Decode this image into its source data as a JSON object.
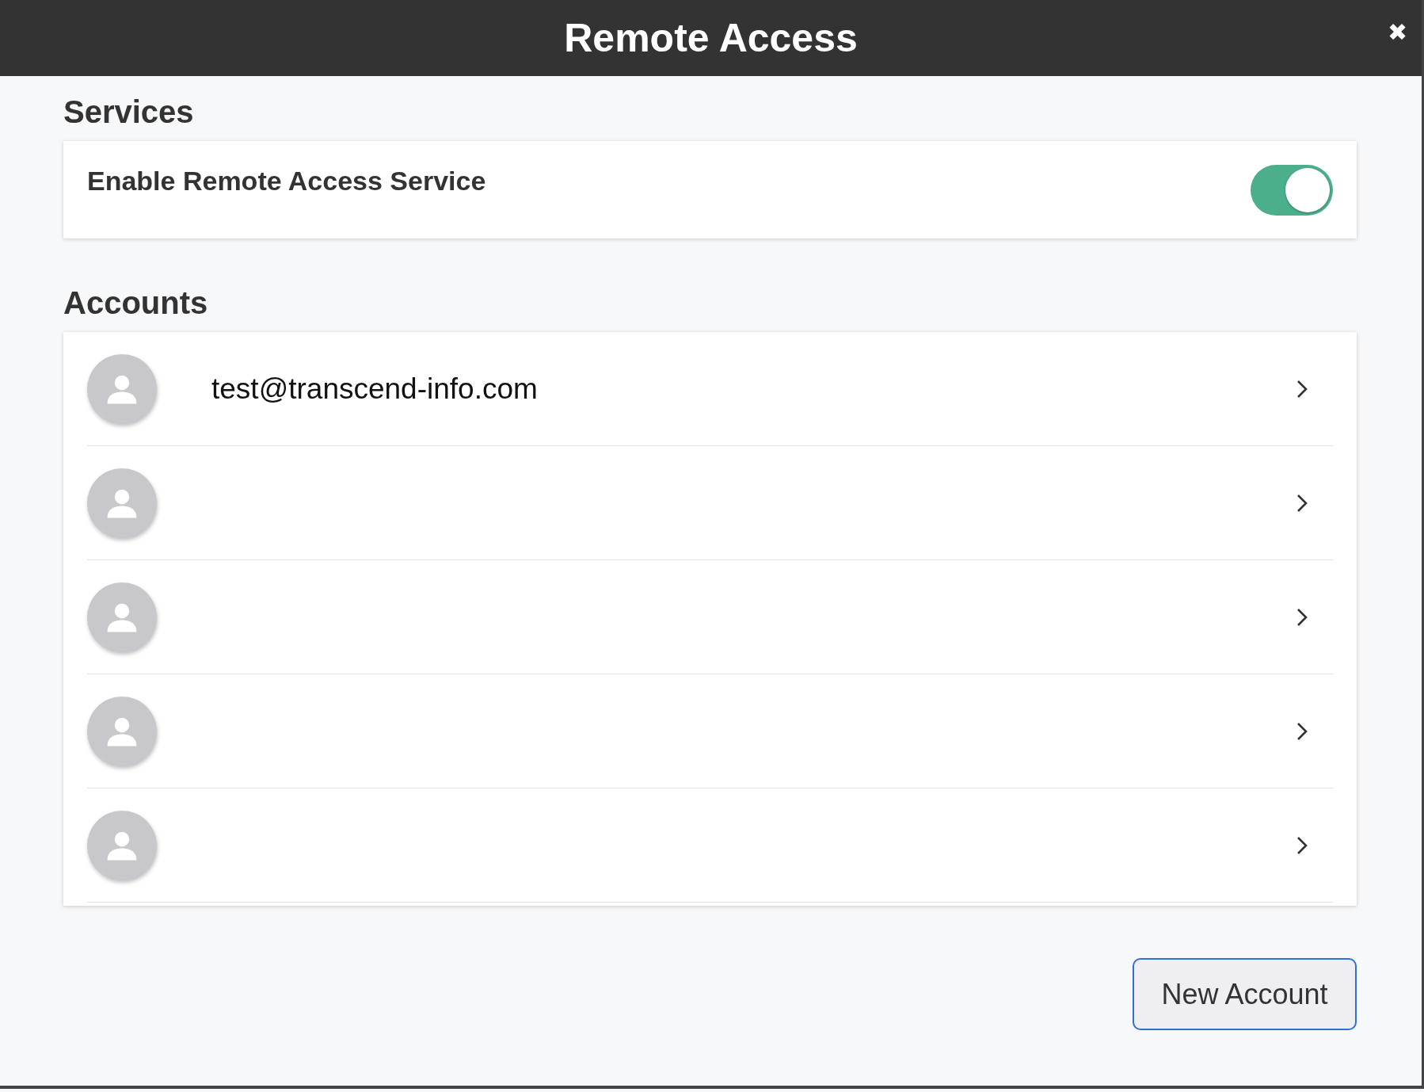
{
  "window": {
    "title": "Remote Access",
    "close": "✖"
  },
  "services": {
    "heading": "Services",
    "items": [
      {
        "label": "Enable Remote Access Service",
        "on": true
      }
    ]
  },
  "accounts": {
    "heading": "Accounts",
    "rows": [
      {
        "kind": "named",
        "email": "test@transcend-info.com"
      },
      {
        "kind": "blank"
      },
      {
        "kind": "blank"
      },
      {
        "kind": "blank"
      },
      {
        "kind": "blank"
      }
    ]
  },
  "buttons": [
    {
      "label": "New Account"
    }
  ]
}
